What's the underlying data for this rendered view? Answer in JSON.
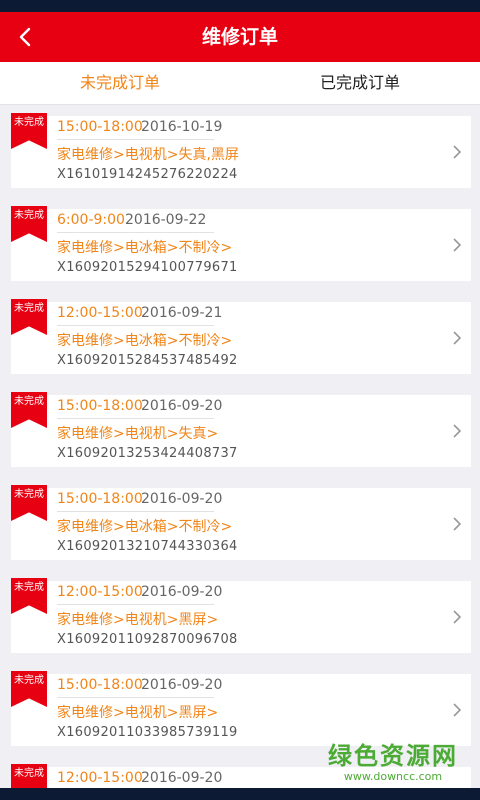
{
  "header": {
    "title": "维修订单",
    "back_icon": "chevron-left-icon"
  },
  "tabs": [
    {
      "label": "未完成订单",
      "active": true
    },
    {
      "label": "已完成订单",
      "active": false
    }
  ],
  "colors": {
    "brand_red": "#e60012",
    "accent_orange": "#f08519"
  },
  "orders": [
    {
      "status": "未完成",
      "time": "15:00-18:00",
      "date": "2016-10-19",
      "service": "家电维修>电视机>失真,黑屏",
      "order_no": "X16101914245276220224"
    },
    {
      "status": "未完成",
      "time": "6:00-9:00",
      "date": "2016-09-22",
      "service": "家电维修>电冰箱>不制冷>",
      "order_no": "X16092015294100779671"
    },
    {
      "status": "未完成",
      "time": "12:00-15:00",
      "date": "2016-09-21",
      "service": "家电维修>电冰箱>不制冷>",
      "order_no": "X16092015284537485492"
    },
    {
      "status": "未完成",
      "time": "15:00-18:00",
      "date": "2016-09-20",
      "service": "家电维修>电视机>失真>",
      "order_no": "X16092013253424408737"
    },
    {
      "status": "未完成",
      "time": "15:00-18:00",
      "date": "2016-09-20",
      "service": "家电维修>电冰箱>不制冷>",
      "order_no": "X16092013210744330364"
    },
    {
      "status": "未完成",
      "time": "12:00-15:00",
      "date": "2016-09-20",
      "service": "家电维修>电视机>黑屏>",
      "order_no": "X16092011092870096708"
    },
    {
      "status": "未完成",
      "time": "15:00-18:00",
      "date": "2016-09-20",
      "service": "家电维修>电视机>黑屏>",
      "order_no": "X16092011033985739119"
    },
    {
      "status": "未完成",
      "time": "12:00-15:00",
      "date": "2016-09-20",
      "service": "",
      "order_no": ""
    }
  ],
  "watermark": {
    "main": "绿色资源网",
    "sub": "www.downcc.com"
  }
}
